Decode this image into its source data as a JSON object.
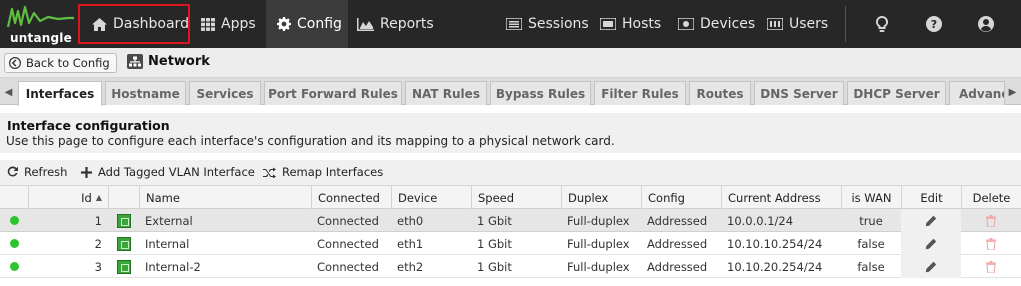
{
  "brand": {
    "logo_text": "untangle",
    "accent": "#e0141e"
  },
  "nav": {
    "dashboard": "Dashboard",
    "apps": "Apps",
    "config": "Config",
    "reports": "Reports",
    "sessions": "Sessions",
    "hosts": "Hosts",
    "devices": "Devices",
    "users": "Users",
    "right_icons": [
      "lightbulb-icon",
      "help-icon",
      "account-icon"
    ]
  },
  "breadcrumb": {
    "back_label": "Back to Config",
    "title": "Network"
  },
  "tabs": [
    {
      "label": "Interfaces",
      "active": true
    },
    {
      "label": "Hostname"
    },
    {
      "label": "Services"
    },
    {
      "label": "Port Forward Rules"
    },
    {
      "label": "NAT Rules"
    },
    {
      "label": "Bypass Rules"
    },
    {
      "label": "Filter Rules"
    },
    {
      "label": "Routes"
    },
    {
      "label": "DNS Server"
    },
    {
      "label": "DHCP Server"
    },
    {
      "label": "Advanc"
    }
  ],
  "panel": {
    "title": "Interface configuration",
    "description": "Use this page to configure each interface's configuration and its mapping to a physical network card."
  },
  "toolbar": {
    "refresh": "Refresh",
    "add_vlan": "Add Tagged VLAN Interface",
    "remap": "Remap Interfaces"
  },
  "grid": {
    "columns": {
      "id": "Id",
      "name": "Name",
      "connected": "Connected",
      "device": "Device",
      "speed": "Speed",
      "duplex": "Duplex",
      "config": "Config",
      "address": "Current Address",
      "is_wan": "is WAN",
      "edit": "Edit",
      "delete": "Delete"
    },
    "sort_indicator": "▲",
    "rows": [
      {
        "id": "1",
        "name": "External",
        "connected": "Connected",
        "device": "eth0",
        "speed": "1 Gbit",
        "duplex": "Full-duplex",
        "config": "Addressed",
        "address": "10.0.0.1/24",
        "is_wan": "true"
      },
      {
        "id": "2",
        "name": "Internal",
        "connected": "Connected",
        "device": "eth1",
        "speed": "1 Gbit",
        "duplex": "Full-duplex",
        "config": "Addressed",
        "address": "10.10.10.254/24",
        "is_wan": "false"
      },
      {
        "id": "3",
        "name": "Internal-2",
        "connected": "Connected",
        "device": "eth2",
        "speed": "1 Gbit",
        "duplex": "Full-duplex",
        "config": "Addressed",
        "address": "10.10.20.254/24",
        "is_wan": "false"
      }
    ]
  }
}
